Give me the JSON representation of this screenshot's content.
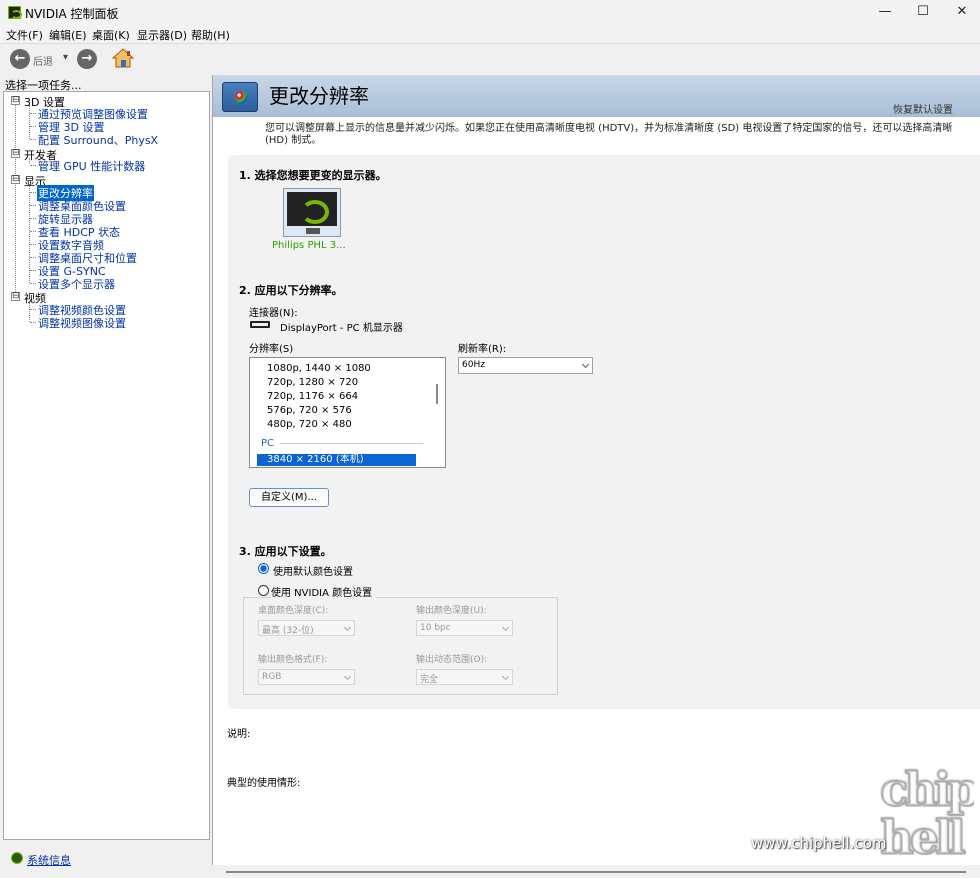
{
  "window": {
    "title": "NVIDIA 控制面板",
    "minimize": "—",
    "maximize": "☐",
    "close": "✕"
  },
  "menu": [
    "文件(F)",
    "编辑(E)",
    "桌面(K)",
    "显示器(D)",
    "帮助(H)"
  ],
  "toolbar": {
    "back_label": "后退",
    "back_arrow": "←",
    "forward_arrow": "→",
    "dropdown": "▾"
  },
  "sidebar": {
    "heading": "选择一项任务...",
    "categories": [
      {
        "label": "3D 设置",
        "expander": "⊟",
        "items": [
          "通过预览调整图像设置",
          "管理 3D 设置",
          "配置 Surround、PhysX"
        ]
      },
      {
        "label": "开发者",
        "expander": "⊟",
        "items": [
          "管理 GPU 性能计数器"
        ]
      },
      {
        "label": "显示",
        "expander": "⊟",
        "items": [
          "更改分辨率",
          "调整桌面颜色设置",
          "旋转显示器",
          "查看 HDCP 状态",
          "设置数字音频",
          "调整桌面尺寸和位置",
          "设置 G-SYNC",
          "设置多个显示器"
        ]
      },
      {
        "label": "视频",
        "expander": "⊟",
        "items": [
          "调整视频颜色设置",
          "调整视频图像设置"
        ]
      }
    ],
    "system_info": "系统信息"
  },
  "page": {
    "title": "更改分辨率",
    "restore_defaults": "恢复默认设置",
    "description": "您可以调整屏幕上显示的信息量并减少闪烁。如果您正在使用高清晰度电视 (HDTV)，并为标准清晰度 (SD) 电视设置了特定国家的信号，还可以选择高清晰 (HD) 制式。"
  },
  "step1": {
    "title": "1. 选择您想要更变的显示器。",
    "monitor_name": "Philips PHL 3..."
  },
  "step2": {
    "title": "2. 应用以下分辨率。",
    "connector_label": "连接器(N):",
    "connector_value": "DisplayPort - PC 机显示器",
    "resolution_label": "分辨率(S)",
    "resolution_rows": [
      "1080p, 1440 × 1080",
      "720p, 1280 × 720",
      "720p, 1176 × 664",
      "576p, 720 × 576",
      "480p, 720 × 480"
    ],
    "resolution_group": "PC",
    "resolution_selected": "3840 × 2160 (本机)",
    "refresh_label": "刷新率(R):",
    "refresh_value": "60Hz",
    "custom_button": "自定义(M)..."
  },
  "step3": {
    "title": "3. 应用以下设置。",
    "option_default": "使用默认颜色设置",
    "option_nvidia": "使用 NVIDIA 颜色设置",
    "desktop_depth_label": "桌面颜色深度(C):",
    "desktop_depth_value": "最高 (32-位)",
    "output_depth_label": "输出颜色深度(U):",
    "output_depth_value": "10 bpc",
    "output_format_label": "输出颜色格式(F):",
    "output_format_value": "RGB",
    "output_range_label": "输出动态范围(O):",
    "output_range_value": "完全"
  },
  "footer": {
    "description_label": "说明:",
    "usage_label": "典型的使用情形:"
  },
  "watermark": {
    "logo": "chip hell",
    "url": "www.chiphell.com"
  }
}
